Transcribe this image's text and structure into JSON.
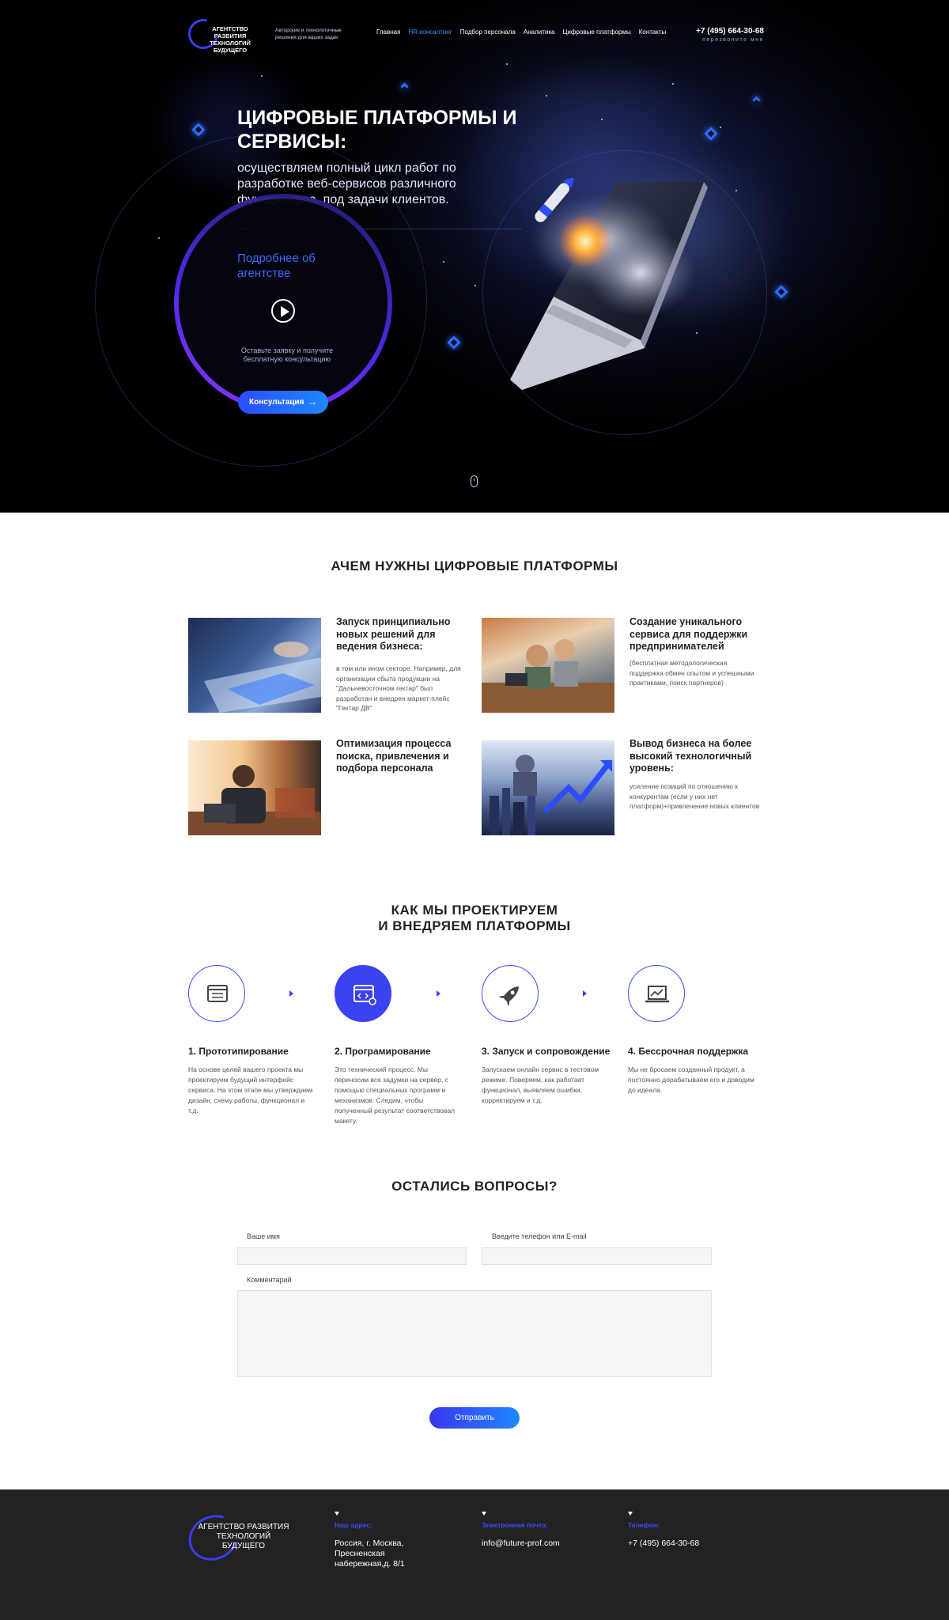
{
  "header": {
    "logo_text": "АГЕНТСТВО РАЗВИТИЯ ТЕХНОЛОГИЙ БУДУЩЕГО",
    "tagline": "Авторские и технологичные решения для ваших задач",
    "nav": [
      "Главная",
      "HR-консалтинг",
      "Подбор персонала",
      "Аналитика",
      "Цифровые платформы",
      "Контакты"
    ],
    "active_nav": "HR-консалтинг",
    "phone": "+7 (495) 664-30-68",
    "callback": "перезвоните мне"
  },
  "hero": {
    "title": "ЦИФРОВЫЕ ПЛАТФОРМЫ И СЕРВИСЫ:",
    "lead": "осуществляем полный цикл работ по разработке веб-сервисов различного функционала, под задачи клиентов.",
    "more": "Подробнее об агентстве",
    "note": "Оставьте заявку и получите бесплатную консультацию",
    "cta": "Консультация",
    "accent": "#2c6bff"
  },
  "why": {
    "title": "АЧЕМ НУЖНЫ ЦИФРОВЫЕ ПЛАТФОРМЫ",
    "cards": [
      {
        "heading": "Запуск принципиально новых решений для ведения бизнеса:",
        "text": "в том или ином секторе. Например, для организации сбыта продукции на \"Дальневосточном гектар\" был разработан и внедрен маркет-плейс \"Гектар ДВ\""
      },
      {
        "heading": "Создание уникального сервиса для поддержки предпринимателей",
        "text": "(бесплатная методологическая поддержка обмен опытом и успешными практиками, поиск партнеров)"
      },
      {
        "heading": "Оптимизация процесса поиска, привлечения и подбора персонала",
        "text": ""
      },
      {
        "heading": "Вывод бизнеса на более высокий технологичный уровень:",
        "text": "усиление позиций по отношению к конкурентам (если у них нет платформ)+привлечение новых клиентов"
      }
    ]
  },
  "process": {
    "title_line1": "КАК МЫ ПРОЕКТИРУЕМ",
    "title_line2": "И ВНЕДРЯЕМ ПЛАТФОРМЫ",
    "steps": [
      {
        "icon": "browser-settings-icon",
        "heading": "1. Прототипирование",
        "text": "На основе целей вашего проекта мы проектируем будущий интерфейс сервиса. На этом этапе мы утверждаем дизайн, схему работы, функционал и т.д."
      },
      {
        "icon": "code-window-icon",
        "heading": "2. Програмирование",
        "text": "Это технический процесс. Мы переносим все задумки на сервер, с помощью специальных программ и механизмов. Следим, чтобы полученный результат соответствовал макету."
      },
      {
        "icon": "rocket-icon",
        "heading": "3. Запуск и сопровождение",
        "text": "Запускаем онлайн сервис в тестовом режиме. Поверяем, как работает функционал, выявляем ошибки, корректируем и т.д."
      },
      {
        "icon": "laptop-chart-icon",
        "heading": "4. Бессрочная поддержка",
        "text": "Мы не бросаем созданный продукт, а постоянно дорабатываем его и доводим до идеала."
      }
    ]
  },
  "form": {
    "title": "ОСТАЛИСЬ ВОПРОСЫ?",
    "name_label": "Ваше имя",
    "contact_label": "Введите телефон или E-mail",
    "comment_label": "Комментарий",
    "submit": "Отправить"
  },
  "footer": {
    "logo_text": "АГЕНТСТВО РАЗВИТИЯ ТЕХНОЛОГИЙ БУДУЩЕГО",
    "address_label": "Наш адрес:",
    "address": "Россия, г. Москва, Пресненская набережная,д. 8/1",
    "email_label": "Электронная почта:",
    "email": "info@future-prof.com",
    "phone_label": "Телефон:",
    "phone": "+7 (495) 664-30-68"
  }
}
